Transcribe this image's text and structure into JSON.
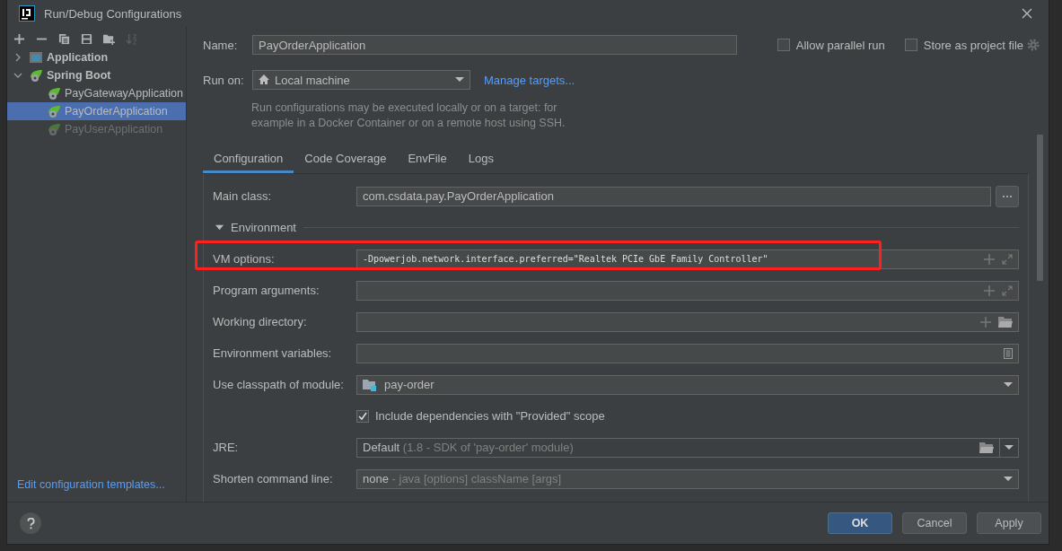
{
  "window": {
    "title": "Run/Debug Configurations"
  },
  "toolbar": [
    {
      "kind": "add",
      "disabled": false
    },
    {
      "kind": "remove",
      "disabled": false
    },
    {
      "kind": "copy",
      "disabled": false
    },
    {
      "kind": "save",
      "disabled": false
    },
    {
      "kind": "folder",
      "disabled": false
    },
    {
      "kind": "sort",
      "disabled": true
    }
  ],
  "tree": [
    {
      "label": "Application",
      "kind": "application",
      "expanded": false,
      "selected": false,
      "disabled": false
    },
    {
      "label": "Spring Boot",
      "kind": "spring",
      "expanded": true,
      "selected": false,
      "disabled": false,
      "children": [
        {
          "label": "PayGatewayApplication",
          "kind": "spring",
          "selected": false,
          "disabled": false
        },
        {
          "label": "PayOrderApplication",
          "kind": "spring",
          "selected": true,
          "disabled": false
        },
        {
          "label": "PayUserApplication",
          "kind": "spring",
          "selected": false,
          "disabled": true
        }
      ]
    }
  ],
  "templates_link": "Edit configuration templates...",
  "name": {
    "label": "Name:",
    "value": "PayOrderApplication"
  },
  "options": [
    {
      "label": "Allow parallel run",
      "checked": false
    },
    {
      "label": "Store as project file",
      "checked": false
    }
  ],
  "run_on": {
    "label": "Run on:",
    "value": "Local machine",
    "link": "Manage targets..."
  },
  "description": [
    "Run configurations may be executed locally or on a target: for",
    "example in a Docker Container or on a remote host using SSH."
  ],
  "tabs": [
    {
      "label": "Configuration",
      "selected": true
    },
    {
      "label": "Code Coverage",
      "selected": false
    },
    {
      "label": "EnvFile",
      "selected": false
    },
    {
      "label": "Logs",
      "selected": false
    }
  ],
  "fields": [
    {
      "kind": "browse",
      "label": "Main class:",
      "value": "com.csdata.pay.PayOrderApplication"
    },
    {
      "kind": "section",
      "label": "Environment",
      "expanded": true
    },
    {
      "kind": "expand",
      "label": "VM options:",
      "value": "-Dpowerjob.network.interface.preferred=\"Realtek PCIe GbE Family Controller\"",
      "highlighted": true
    },
    {
      "kind": "expand",
      "label": "Program arguments:",
      "highlighted": false
    },
    {
      "kind": "directory",
      "label": "Working directory:"
    },
    {
      "kind": "env",
      "label": "Environment variables:"
    },
    {
      "kind": "module",
      "label": "Use classpath of module:",
      "value": "pay-order"
    },
    {
      "kind": "checkbox",
      "label": "Include dependencies with \"Provided\" scope",
      "checked": true
    },
    {
      "kind": "jre",
      "label": "JRE:",
      "value": "Default",
      "hint": "(1.8 - SDK of 'pay-order' module)"
    },
    {
      "kind": "select",
      "label": "Shorten command line:",
      "value": "none",
      "hint": "- java [options] className [args]"
    }
  ],
  "buttons": [
    {
      "label": "OK",
      "default": true
    },
    {
      "label": "Cancel",
      "default": false
    },
    {
      "label": "Apply",
      "default": false
    }
  ]
}
